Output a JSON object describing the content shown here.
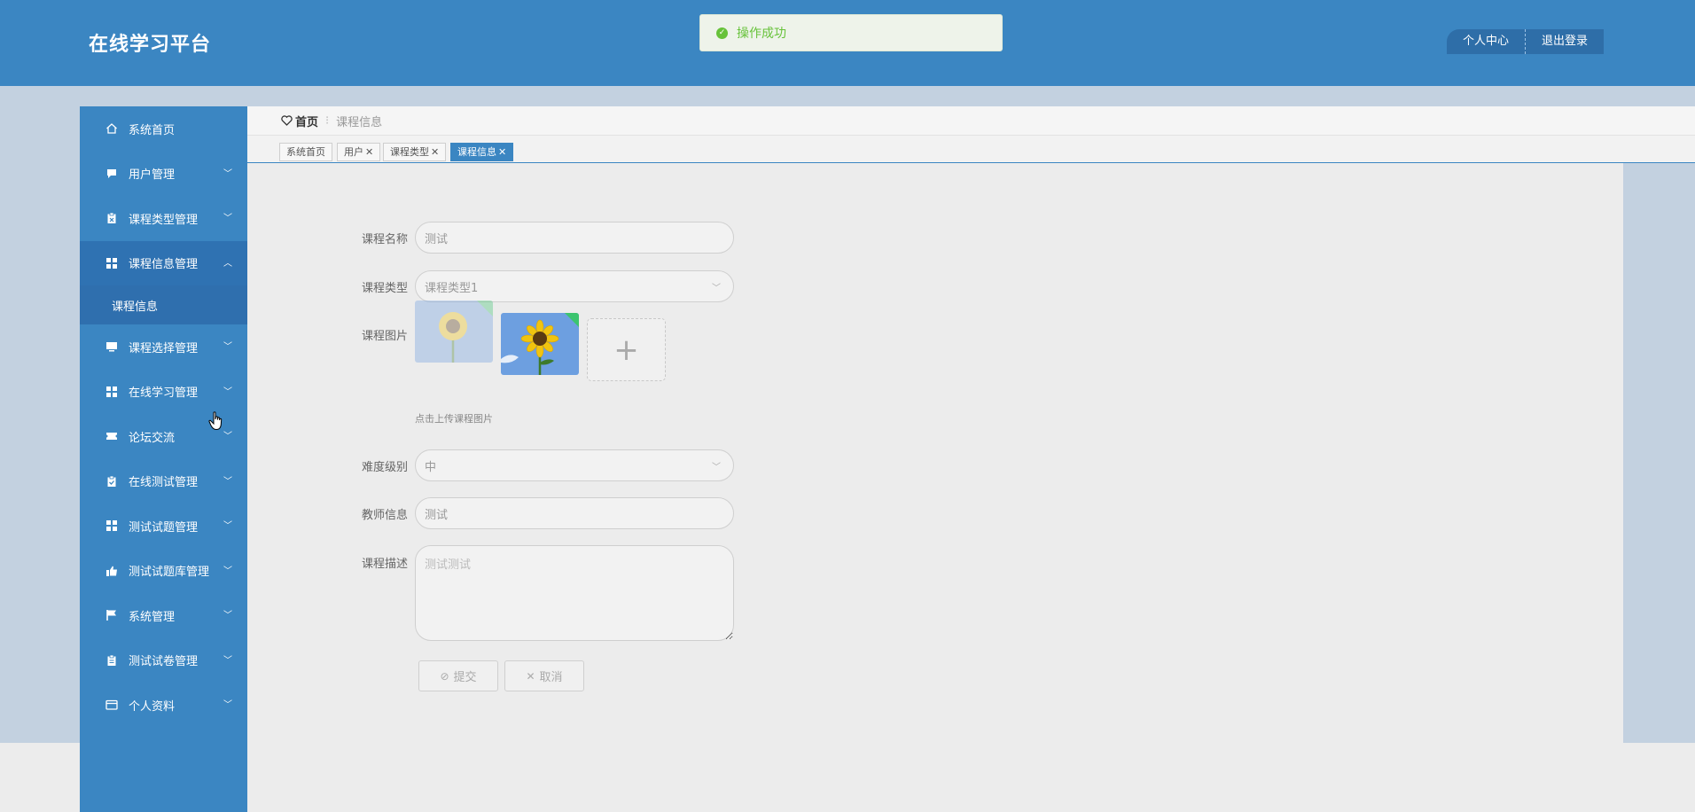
{
  "app": {
    "title": "在线学习平台"
  },
  "toast": {
    "message": "操作成功",
    "color": "#67c23a"
  },
  "header": {
    "profile_label": "个人中心",
    "logout_label": "退出登录"
  },
  "colors": {
    "primary": "#3b86c2",
    "active_menu": "#2f72b2"
  },
  "sidebar": {
    "items": [
      {
        "label": "系统首页",
        "icon": "home-icon"
      },
      {
        "label": "用户管理",
        "icon": "chat-icon"
      },
      {
        "label": "课程类型管理",
        "icon": "clipboard-icon"
      },
      {
        "label": "课程信息管理",
        "icon": "grid-icon",
        "expanded": true
      },
      {
        "label": "课程选择管理",
        "icon": "monitor-icon"
      },
      {
        "label": "在线学习管理",
        "icon": "grid-icon"
      },
      {
        "label": "论坛交流",
        "icon": "ticket-icon"
      },
      {
        "label": "在线测试管理",
        "icon": "clipboard-check-icon"
      },
      {
        "label": "测试试题管理",
        "icon": "grid-icon"
      },
      {
        "label": "测试试题库管理",
        "icon": "thumb-up-icon"
      },
      {
        "label": "系统管理",
        "icon": "flag-icon"
      },
      {
        "label": "测试试卷管理",
        "icon": "clipboard-icon"
      },
      {
        "label": "个人资料",
        "icon": "card-icon"
      }
    ],
    "submenu": {
      "label": "课程信息"
    }
  },
  "breadcrumb": {
    "home": "首页",
    "current": "课程信息"
  },
  "tabs": [
    {
      "label": "系统首页",
      "closable": false
    },
    {
      "label": "用户",
      "closable": true
    },
    {
      "label": "课程类型",
      "closable": true
    },
    {
      "label": "课程信息",
      "closable": true,
      "active": true
    }
  ],
  "form": {
    "course_name": {
      "label": "课程名称",
      "value": "测试"
    },
    "course_type": {
      "label": "课程类型",
      "value": "课程类型1"
    },
    "course_image": {
      "label": "课程图片",
      "hint": "点击上传课程图片"
    },
    "difficulty": {
      "label": "难度级别",
      "value": "中"
    },
    "teacher": {
      "label": "教师信息",
      "value": "测试"
    },
    "description": {
      "label": "课程描述",
      "value": "测试测试"
    },
    "submit_label": "提交",
    "cancel_label": "取消"
  }
}
